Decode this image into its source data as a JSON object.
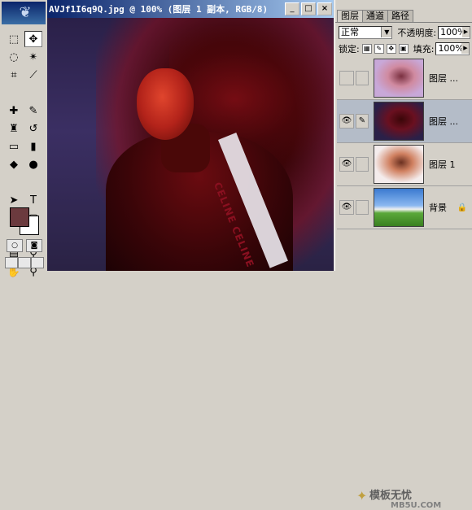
{
  "window": {
    "title": "AVJf1I6q9Q.jpg @ 100% (图层 1 副本, RGB/8)",
    "minimize": "_",
    "maximize": "□",
    "close": "×"
  },
  "toolbox": {
    "tools": [
      {
        "name": "marquee-tool-icon",
        "glyph": "⬚"
      },
      {
        "name": "move-tool-icon",
        "glyph": "✥"
      },
      {
        "name": "lasso-tool-icon",
        "glyph": "◌"
      },
      {
        "name": "magic-wand-tool-icon",
        "glyph": "✴"
      },
      {
        "name": "crop-tool-icon",
        "glyph": "⌗"
      },
      {
        "name": "slice-tool-icon",
        "glyph": "⟋"
      },
      {
        "name": "healing-brush-tool-icon",
        "glyph": "✚"
      },
      {
        "name": "brush-tool-icon",
        "glyph": "✎"
      },
      {
        "name": "clone-stamp-tool-icon",
        "glyph": "♜"
      },
      {
        "name": "history-brush-tool-icon",
        "glyph": "↺"
      },
      {
        "name": "eraser-tool-icon",
        "glyph": "▭"
      },
      {
        "name": "gradient-tool-icon",
        "glyph": "▮"
      },
      {
        "name": "blur-tool-icon",
        "glyph": "◆"
      },
      {
        "name": "dodge-tool-icon",
        "glyph": "●"
      },
      {
        "name": "path-selection-tool-icon",
        "glyph": "➤"
      },
      {
        "name": "type-tool-icon",
        "glyph": "T"
      },
      {
        "name": "pen-tool-icon",
        "glyph": "✒"
      },
      {
        "name": "shape-tool-icon",
        "glyph": "▢"
      },
      {
        "name": "notes-tool-icon",
        "glyph": "▤"
      },
      {
        "name": "eyedropper-tool-icon",
        "glyph": "⚲"
      },
      {
        "name": "hand-tool-icon",
        "glyph": "✋"
      },
      {
        "name": "zoom-tool-icon",
        "glyph": "⚲"
      }
    ],
    "foreground_color": "#6b3a3e",
    "background_color": "#ffffff"
  },
  "panel": {
    "tabs": [
      "图层",
      "通道",
      "路径"
    ],
    "blend_mode": "正常",
    "opacity_label": "不透明度:",
    "opacity_value": "100%",
    "lock_label": "锁定:",
    "fill_label": "填充:",
    "fill_value": "100%",
    "layers": [
      {
        "name": "图层 ...",
        "visible": false,
        "selected": false
      },
      {
        "name": "图层 ...",
        "visible": true,
        "selected": true
      },
      {
        "name": "图层 1",
        "visible": true,
        "selected": false
      },
      {
        "name": "背景",
        "visible": true,
        "selected": false
      }
    ]
  },
  "watermark": {
    "text": "模板无忧",
    "url": "MB5U.COM"
  },
  "canvas": {
    "stripe_text": "CELINE CELINE"
  }
}
